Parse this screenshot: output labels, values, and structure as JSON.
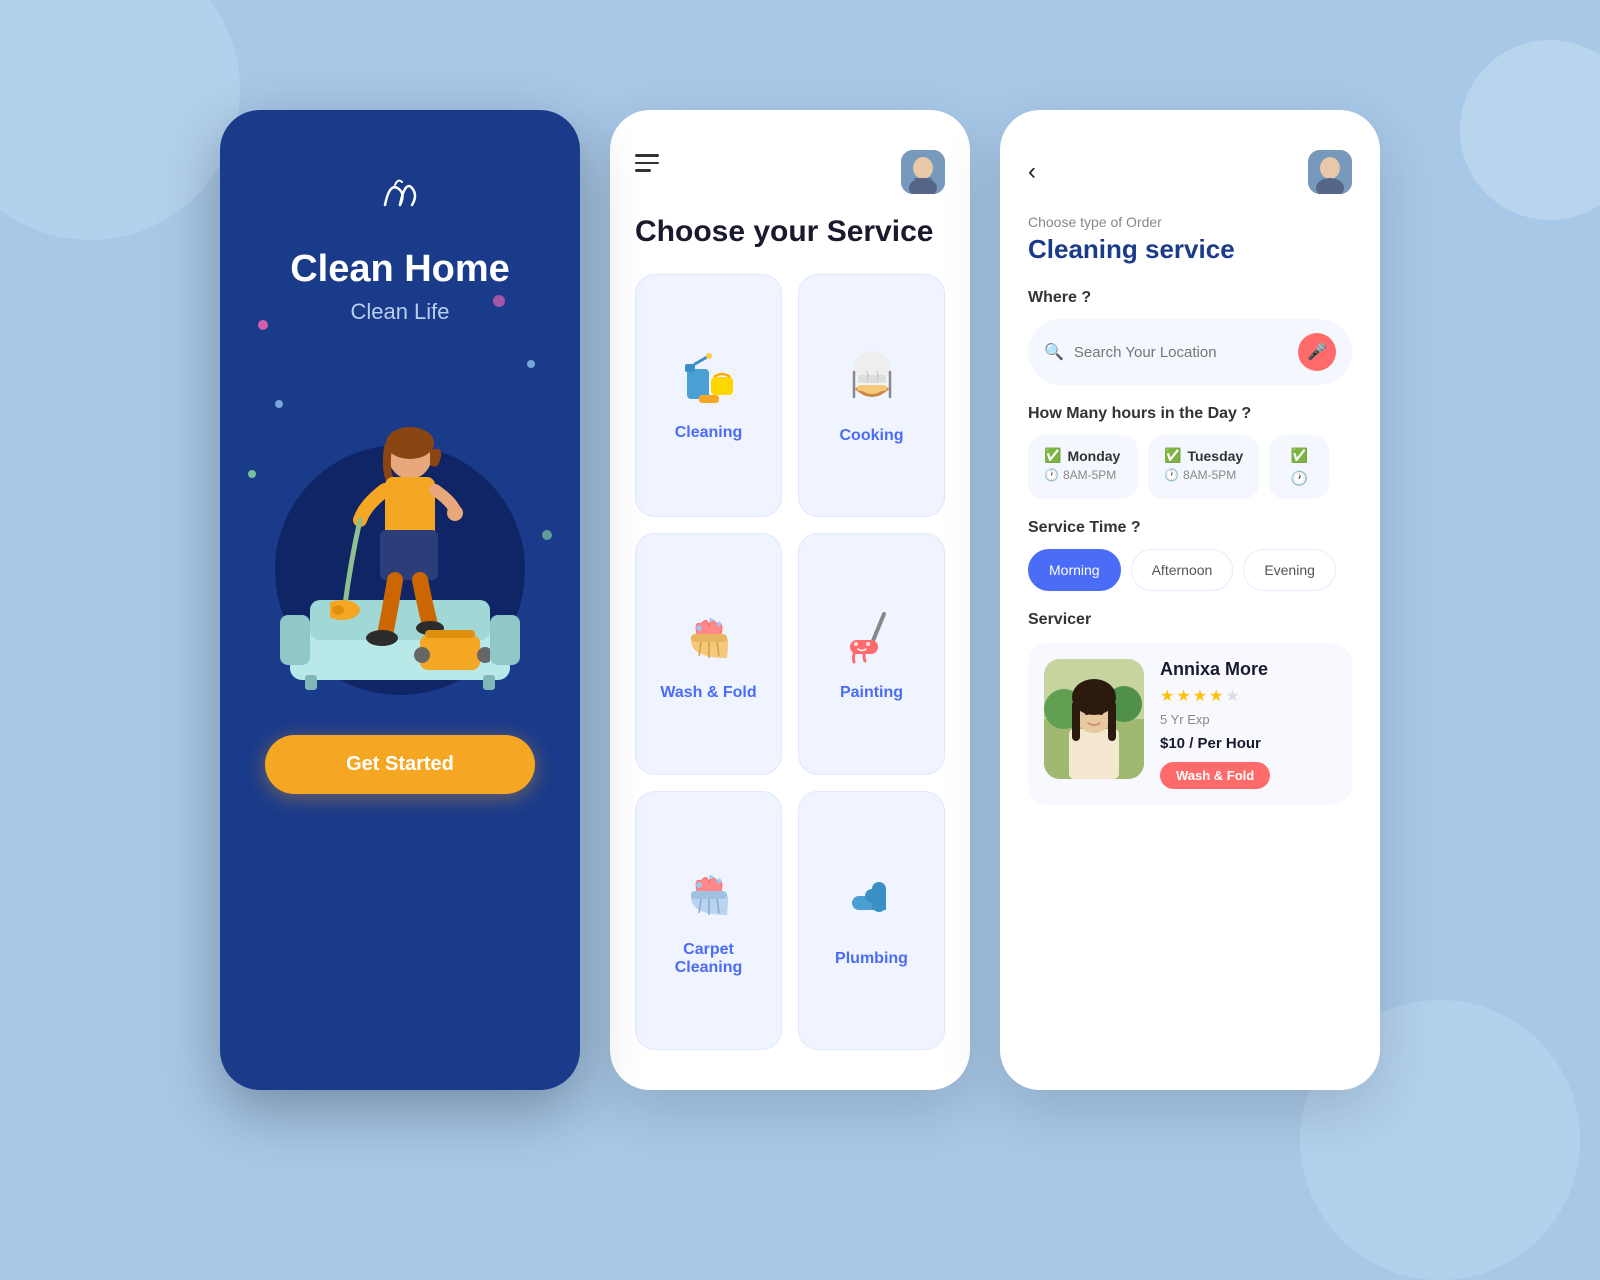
{
  "background": {
    "color": "#a8c8e8"
  },
  "screen1": {
    "logo": "𝒩",
    "title": "Clean Home",
    "subtitle": "Clean Life",
    "cta_label": "Get Started"
  },
  "screen2": {
    "title": "Choose your Service",
    "avatar_emoji": "👩",
    "services": [
      {
        "id": "cleaning",
        "label": "Cleaning",
        "icon": "🧴"
      },
      {
        "id": "cooking",
        "label": "Cooking",
        "icon": "🍳"
      },
      {
        "id": "wash-fold",
        "label": "Wash & Fold",
        "icon": "🧺"
      },
      {
        "id": "painting",
        "label": "Painting",
        "icon": "🖌️"
      },
      {
        "id": "carpet-cleaning",
        "label": "Carpet Cleaning",
        "icon": "🧹"
      },
      {
        "id": "plumbing",
        "label": "Plumbing",
        "icon": "🔧"
      }
    ]
  },
  "screen3": {
    "back_label": "‹",
    "order_type_label": "Choose type of Order",
    "service_title": "Cleaning service",
    "where_label": "Where ?",
    "location_placeholder": "Search Your Location",
    "hours_label": "How Many hours in the Day ?",
    "days": [
      {
        "name": "Monday",
        "time": "8AM-5PM",
        "checked": true
      },
      {
        "name": "Tuesday",
        "time": "8AM-5PM",
        "checked": true
      },
      {
        "name": "",
        "time": "",
        "partial": true
      }
    ],
    "service_time_label": "Service Time ?",
    "time_slots": [
      {
        "label": "Morning",
        "active": true
      },
      {
        "label": "Afternoon",
        "active": false
      },
      {
        "label": "Evening",
        "active": false
      }
    ],
    "servicer_label": "Servicer",
    "servicer": {
      "name": "Annixa More",
      "stars": 4,
      "total_stars": 5,
      "exp": "5 Yr Exp",
      "price": "$10 / Per Hour",
      "badge": "Wash & Fold"
    },
    "avatar_emoji": "👩"
  }
}
